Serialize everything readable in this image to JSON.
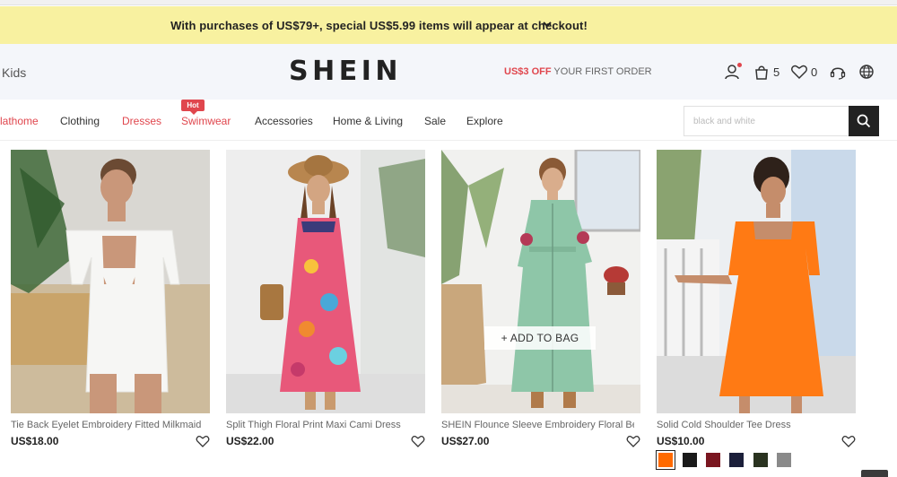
{
  "promo": {
    "text": "With purchases of US$79+, special US$5.99 items will appear at checkout!",
    "chevron_icon": "chevron-down-icon"
  },
  "header": {
    "kids_label": "Kids",
    "logo": "SHEIN",
    "offer_highlight": "US$3 OFF",
    "offer_rest": " YOUR FIRST ORDER",
    "bag_count": "5",
    "wishlist_count": "0",
    "icons": [
      "user-icon",
      "bag-icon",
      "heart-icon",
      "headset-icon",
      "globe-icon"
    ]
  },
  "nav": {
    "items": [
      {
        "label": "lathome",
        "color": "#e0464d"
      },
      {
        "label": "Clothing",
        "color": "#333333"
      },
      {
        "label": "Dresses",
        "color": "#e0464d"
      },
      {
        "label": "Swimwear",
        "color": "#e0464d"
      },
      {
        "label": "Accessories",
        "color": "#333333"
      },
      {
        "label": "Home & Living",
        "color": "#333333"
      },
      {
        "label": "Sale",
        "color": "#333333"
      },
      {
        "label": "Explore",
        "color": "#333333"
      }
    ],
    "hot_badge": "Hot"
  },
  "search": {
    "placeholder": "black and white",
    "button_icon": "search-icon"
  },
  "products": [
    {
      "title": "Tie Back Eyelet Embroidery Fitted Milkmaid ...",
      "price": "US$18.00",
      "dress_color": "#f6f6f4"
    },
    {
      "title": "Split Thigh Floral Print Maxi Cami Dress",
      "price": "US$22.00",
      "dress_color": "#e8587a"
    },
    {
      "title": "SHEIN Flounce Sleeve Embroidery Floral Bel...",
      "price": "US$27.00",
      "dress_color": "#8ec6a8"
    },
    {
      "title": "Solid Cold Shoulder Tee Dress",
      "price": "US$10.00",
      "dress_color": "#ff7a14"
    }
  ],
  "add_to_bag_label": "+ ADD TO BAG",
  "swatches": [
    "#ff6a00",
    "#1a1a1a",
    "#7a1620",
    "#1b1f3a",
    "#2a3320",
    "#8a8a8a"
  ],
  "colors": {
    "accent_red": "#e0464d",
    "promo_bg": "#f8f1a0"
  }
}
